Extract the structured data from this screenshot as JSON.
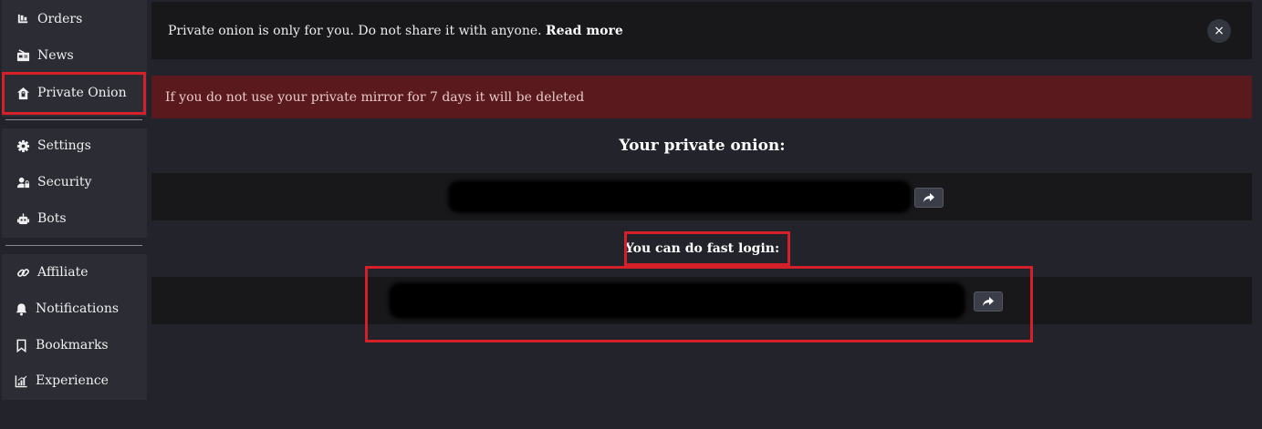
{
  "sidebar": {
    "group1": [
      {
        "label": "Orders",
        "icon": "orders-icon"
      },
      {
        "label": "News",
        "icon": "news-icon"
      },
      {
        "label": "Private Onion",
        "icon": "home-lock-icon"
      }
    ],
    "group2": [
      {
        "label": "Settings",
        "icon": "gear-icon"
      },
      {
        "label": "Security",
        "icon": "user-lock-icon"
      },
      {
        "label": "Bots",
        "icon": "robot-icon"
      }
    ],
    "group3": [
      {
        "label": "Affiliate",
        "icon": "link-icon"
      },
      {
        "label": "Notifications",
        "icon": "bell-icon"
      },
      {
        "label": "Bookmarks",
        "icon": "bookmark-icon"
      },
      {
        "label": "Experience",
        "icon": "chart-icon"
      }
    ]
  },
  "alerts": {
    "info_text": "Private onion is only for you. Do not share it with anyone.",
    "info_link": "Read more",
    "close_symbol": "×",
    "danger_text": "If you do not use your private mirror for 7 days it will be deleted"
  },
  "content": {
    "private_onion_heading": "Your private onion:",
    "fast_login_heading": "You can do fast login:"
  },
  "colors": {
    "background": "#22232b",
    "sidebar_panel": "#2b2c34",
    "box": "#18181b",
    "danger": "#5a1a1d",
    "highlight": "#d42028"
  }
}
